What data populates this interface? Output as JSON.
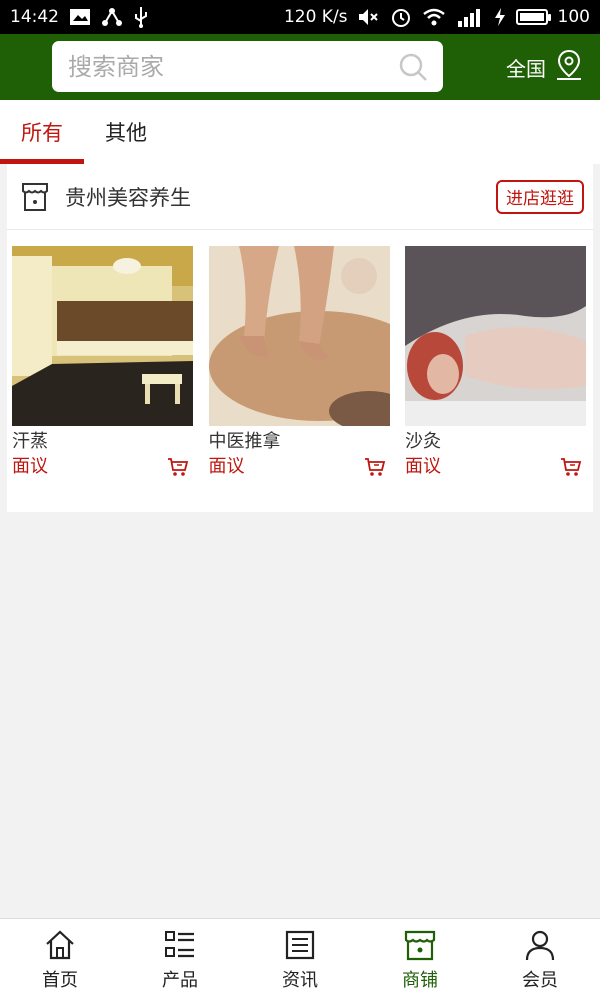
{
  "status_bar": {
    "time": "14:42",
    "speed": "120 K/s",
    "network": "4G",
    "battery": "100"
  },
  "header": {
    "search_placeholder": "搜索商家",
    "region_label": "全国",
    "color": "#1f5f06"
  },
  "tabs": [
    {
      "label": "所有",
      "active": true
    },
    {
      "label": "其他",
      "active": false
    }
  ],
  "shop": {
    "name": "贵州美容养生",
    "visit_button": "进店逛逛",
    "products": [
      {
        "name": "汗蒸",
        "price": "面议"
      },
      {
        "name": "中医推拿",
        "price": "面议"
      },
      {
        "name": "沙灸",
        "price": "面议"
      }
    ]
  },
  "bottom_nav": [
    {
      "label": "首页",
      "icon": "home-icon"
    },
    {
      "label": "产品",
      "icon": "list-icon"
    },
    {
      "label": "资讯",
      "icon": "news-icon"
    },
    {
      "label": "商铺",
      "icon": "store-icon",
      "active": true
    },
    {
      "label": "会员",
      "icon": "user-icon"
    }
  ],
  "colors": {
    "accent": "#c0160f",
    "brand": "#1f5f06"
  }
}
